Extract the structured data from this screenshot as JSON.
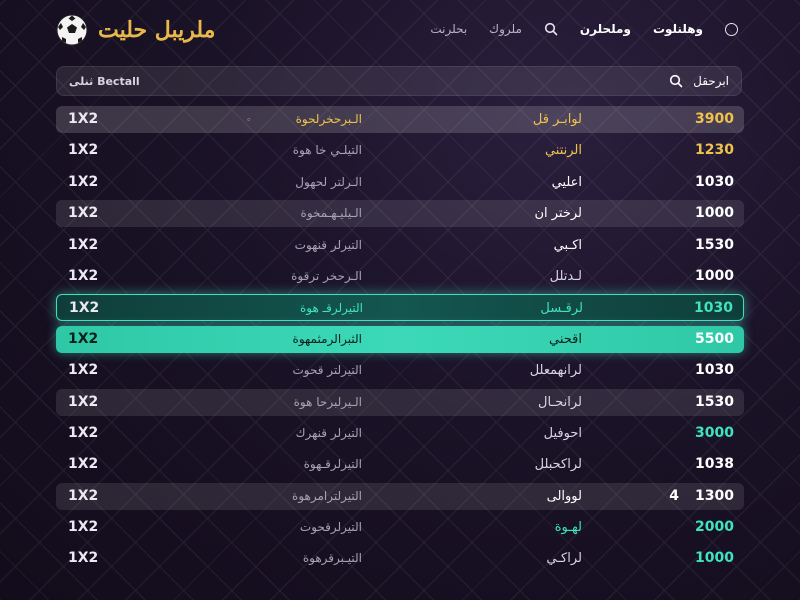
{
  "header": {
    "logo_text": "ملريبل حليت",
    "nav": [
      {
        "label": "وهلنلوت",
        "style": "strong"
      },
      {
        "label": "وملحلرن",
        "style": "strong"
      },
      {
        "label": "",
        "icon": "search-icon"
      },
      {
        "label": "ملروك",
        "style": "dim"
      },
      {
        "label": "بحلرنت",
        "style": "dim"
      }
    ],
    "circle_icon": "circle-icon"
  },
  "search": {
    "label": "ابرحقل",
    "brand_label": "ثنلى Bectall"
  },
  "colors": {
    "gold": "#f0c24c",
    "teal": "#3fe3bf",
    "selected_outline": "#3fe0c0"
  },
  "rows": [
    {
      "odds": "1X2",
      "market": "الـبرحخرلحوة",
      "dot": "◦",
      "team": "لوابـر قل",
      "num": "3900",
      "style": "first",
      "team_color": "gold",
      "market_color": "gold",
      "num_color": "gold"
    },
    {
      "odds": "1X2",
      "market": "التيلـي خا هوة",
      "team": "الرنتني",
      "num": "1230",
      "style": "",
      "team_color": "gold",
      "num_color": "gold"
    },
    {
      "odds": "1X2",
      "market": "الـرلتر لحهول",
      "team": "اعليي",
      "num": "1030",
      "style": "",
      "team_color": "white",
      "num_color": "white"
    },
    {
      "odds": "1X2",
      "market": "الـيليـهـمخوة",
      "team": "لرختر ان",
      "num": "1000",
      "style": "shaded",
      "team_color": "white",
      "num_color": "white"
    },
    {
      "odds": "1X2",
      "market": "التيرلر قنهوت",
      "team": "اكـبي",
      "num": "1530",
      "style": "",
      "team_color": "white",
      "num_color": "white"
    },
    {
      "odds": "1X2",
      "market": "الـرحخر ترقوة",
      "team": "لـدتلل",
      "num": "1000",
      "style": "",
      "team_color": "",
      "num_color": "white"
    },
    {
      "odds": "1X2",
      "market": "التيرلرقـ هوة",
      "team": "لرقـسل",
      "num": "1030",
      "style": "sel-outline",
      "team_color": "teal",
      "market_color": "teal",
      "num_color": "teal"
    },
    {
      "odds": "1X2",
      "market": "الثبرالرمثمهوة",
      "team": "اقحني",
      "num": "5500",
      "style": "sel-fill",
      "team_color": "dark",
      "market_color": "dark",
      "num_color": "white",
      "odds_color": "dark"
    },
    {
      "odds": "1X2",
      "market": "التيرلتر قحوت",
      "team": "لرانهمعلل",
      "num": "1030",
      "style": "",
      "team_color": "",
      "num_color": "white"
    },
    {
      "odds": "1X2",
      "market": "الـيرلبرحا هوة",
      "team": "لرانحـال",
      "num": "1530",
      "style": "shaded",
      "team_color": "",
      "num_color": "white"
    },
    {
      "odds": "1X2",
      "market": "التيرلر قنهرك",
      "team": "احوفيل",
      "num": "3000",
      "style": "",
      "team_color": "",
      "num_color": "teal"
    },
    {
      "odds": "1X2",
      "market": "التيرلرقـهوة",
      "team": "لراكحبلل",
      "num": "1038",
      "style": "",
      "team_color": "",
      "num_color": "white"
    },
    {
      "odds": "1X2",
      "market": "التيرلترامرهوة",
      "team": "لووالى",
      "num": "1300",
      "num_extra": "4",
      "style": "shaded",
      "team_color": "white",
      "num_color": "white"
    },
    {
      "odds": "1X2",
      "market": "التيرلرقحوت",
      "team": "لهـوة",
      "num": "2000",
      "style": "",
      "team_color": "teal",
      "num_color": "teal"
    },
    {
      "odds": "1X2",
      "market": "التيـبرقرهوة",
      "team": "لراكـي",
      "num": "1000",
      "style": "",
      "team_color": "",
      "num_color": "teal"
    }
  ]
}
